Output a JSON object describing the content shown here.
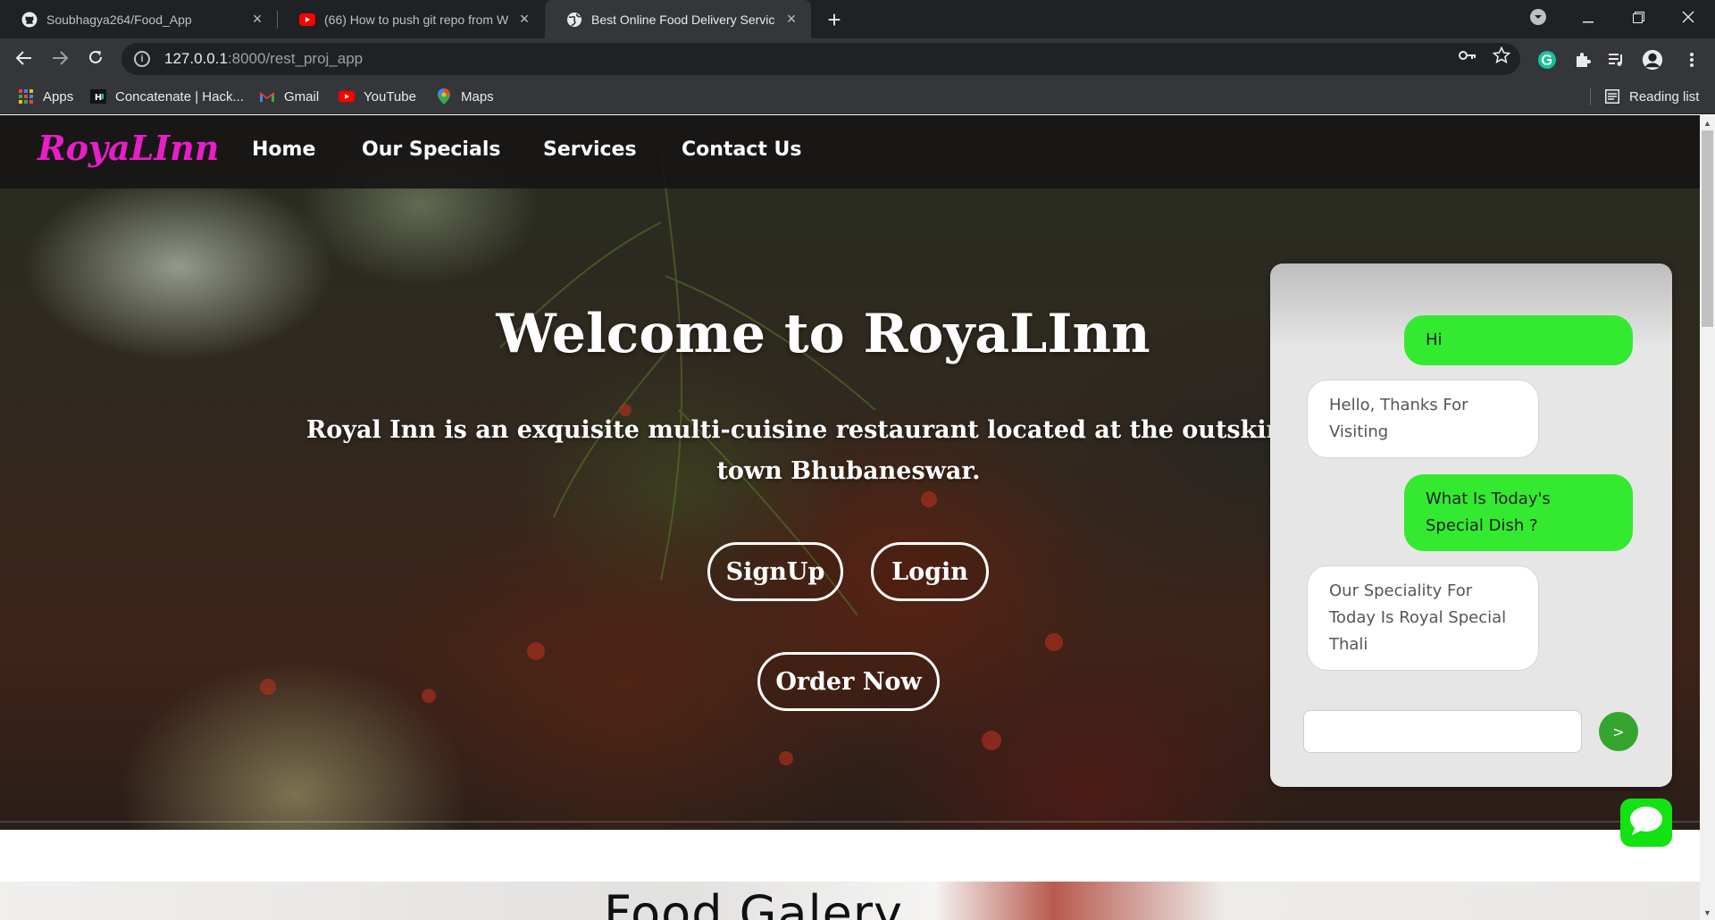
{
  "browser": {
    "tabs": [
      {
        "title": "Soubhagya264/Food_App",
        "icon": "github-icon"
      },
      {
        "title": "(66) How to push git repo from W",
        "icon": "youtube-icon"
      },
      {
        "title": "Best Online Food Delivery Service",
        "icon": "globe-icon"
      }
    ],
    "address": {
      "host": "127.0.0.1",
      "path": ":8000/rest_proj_app"
    },
    "bookmarks": [
      {
        "label": "Apps",
        "icon": "apps-grid-icon"
      },
      {
        "label": "Concatenate | Hack...",
        "icon": "hackerrank-icon"
      },
      {
        "label": "Gmail",
        "icon": "gmail-icon"
      },
      {
        "label": "YouTube",
        "icon": "youtube-icon"
      },
      {
        "label": "Maps",
        "icon": "maps-pin-icon"
      }
    ],
    "reading_list": "Reading list",
    "close_glyph": "×",
    "new_tab_glyph": "+"
  },
  "site": {
    "brand": "RoyaLInn",
    "nav": [
      "Home",
      "Our Specials",
      "Services",
      "Contact Us"
    ],
    "hero": {
      "title": "Welcome to RoyaLInn",
      "description": "Royal Inn is an exquisite multi-cuisine restaurant located at the outskirts of the town Bhubaneswar.",
      "signup": "SignUp",
      "login": "Login",
      "order": "Order Now"
    },
    "gallery_title": "Food Galery"
  },
  "chat": {
    "messages": [
      {
        "from": "user",
        "text": "Hi"
      },
      {
        "from": "bot",
        "text": "Hello, Thanks For Visiting"
      },
      {
        "from": "user",
        "text": "What Is Today's Special Dish ?"
      },
      {
        "from": "bot",
        "text": "Our Speciality For Today Is Royal Special Thali"
      }
    ],
    "input_value": "",
    "send_label": ">"
  },
  "colors": {
    "brand": "#e91ec8",
    "user_bubble": "#33ea31",
    "send_button": "#35a52f",
    "chat_toggle": "#12e312"
  }
}
